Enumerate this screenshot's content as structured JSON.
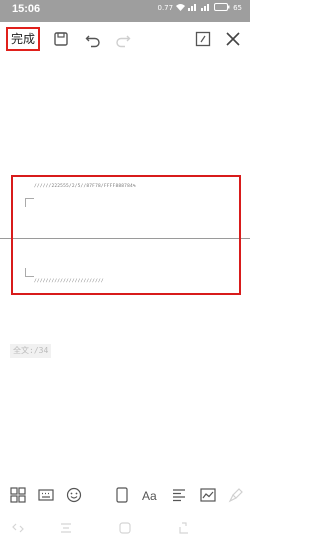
{
  "status_bar": {
    "time": "15:06",
    "network_speed": "0.77",
    "battery": "65"
  },
  "toolbar": {
    "finish_label": "完成"
  },
  "editor": {
    "ref_line_1": "//////222555/2/5//87F78/FFFF888784%",
    "ref_line_2": "////////////////////////"
  },
  "footer": {
    "word_count": "全文:/34"
  },
  "colors": {
    "accent_red": "#e0201b",
    "statusbar_bg": "#9e9e9e"
  },
  "icons": {
    "toolbar": [
      "save-icon",
      "undo-icon",
      "redo-icon",
      "edit-frame-icon",
      "close-icon"
    ],
    "bottom_tools": [
      "grid-icon",
      "keyboard-icon",
      "emoji-icon",
      "page-icon",
      "font-icon",
      "align-icon",
      "chart-icon",
      "brush-icon"
    ],
    "bottom_nav": [
      "nav-back-icon",
      "nav-menu-icon",
      "nav-home-icon",
      "nav-share-icon"
    ]
  }
}
